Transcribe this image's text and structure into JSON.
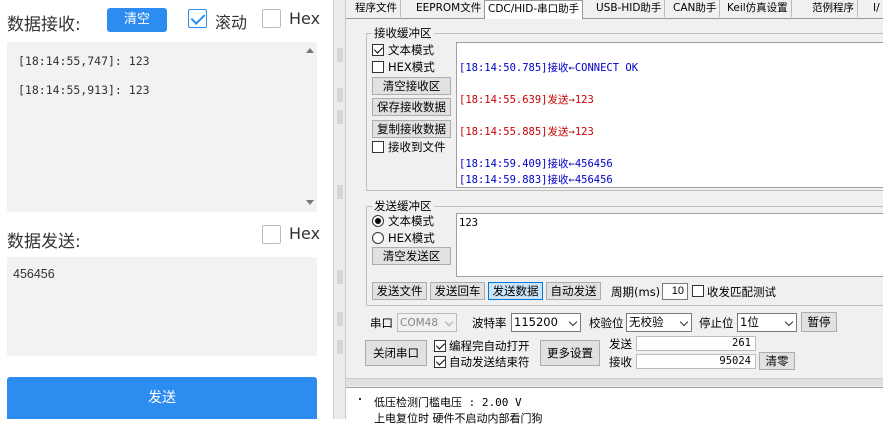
{
  "left": {
    "receive_label": "数据接收:",
    "clear_label": "清空",
    "scroll_label": "滚动",
    "hex_label": "Hex",
    "receive_lines": [
      "[18:14:55,747]: 123",
      "[18:14:55,913]: 123"
    ],
    "send_label": "数据发送:",
    "send_hex_label": "Hex",
    "send_value": "456456",
    "send_button": "发送"
  },
  "right": {
    "tabs": [
      "程序文件",
      "EEPROM文件",
      "CDC/HID-串口助手",
      "USB-HID助手",
      "CAN助手",
      "Keil仿真设置",
      "范例程序",
      "I/"
    ],
    "receive_group": "接收缓冲区",
    "text_mode": "文本模式",
    "hex_mode": "HEX模式",
    "clear_receive": "清空接收区",
    "save_receive": "保存接收数据",
    "copy_receive": "复制接收数据",
    "receive_to_file": "接收到文件",
    "log": [
      {
        "text": "[18:14:50.785]接收←CONNECT OK",
        "color": "#0000c8"
      },
      {
        "text": "[18:14:55.639]发送→123",
        "color": "#c80000"
      },
      {
        "text": "[18:14:55.885]发送→123",
        "color": "#c80000"
      },
      {
        "text": "[18:14:59.409]接收←456456",
        "color": "#0000c8"
      },
      {
        "text": "[18:14:59.883]接收←456456",
        "color": "#0000c8"
      }
    ],
    "send_group": "发送缓冲区",
    "send_text_mode": "文本模式",
    "send_hex_mode": "HEX模式",
    "clear_send": "清空发送区",
    "send_value": "123",
    "send_file": "发送文件",
    "send_enter": "发送回车",
    "send_data": "发送数据",
    "auto_send": "自动发送",
    "period_label": "周期(ms)",
    "period_value": "10",
    "match_test": "收发匹配测试",
    "port_label": "串口",
    "port_value": "COM48",
    "baud_label": "波特率",
    "baud_value": "115200",
    "parity_label": "校验位",
    "parity_value": "无校验",
    "stop_label": "停止位",
    "stop_value": "1位",
    "pause": "暂停",
    "close_port": "关闭串口",
    "auto_open": "编程完自动打开",
    "auto_send_end": "自动发送结束符",
    "more_settings": "更多设置",
    "sent_label": "发送",
    "sent_count": "261",
    "recv_label": "接收",
    "recv_count": "95024",
    "clear_count": "清零",
    "bottom_line1": "低压检测门槛电压 : 2.00 V",
    "bottom_line2": "上电复位时 硬件不启动内部看门狗"
  }
}
